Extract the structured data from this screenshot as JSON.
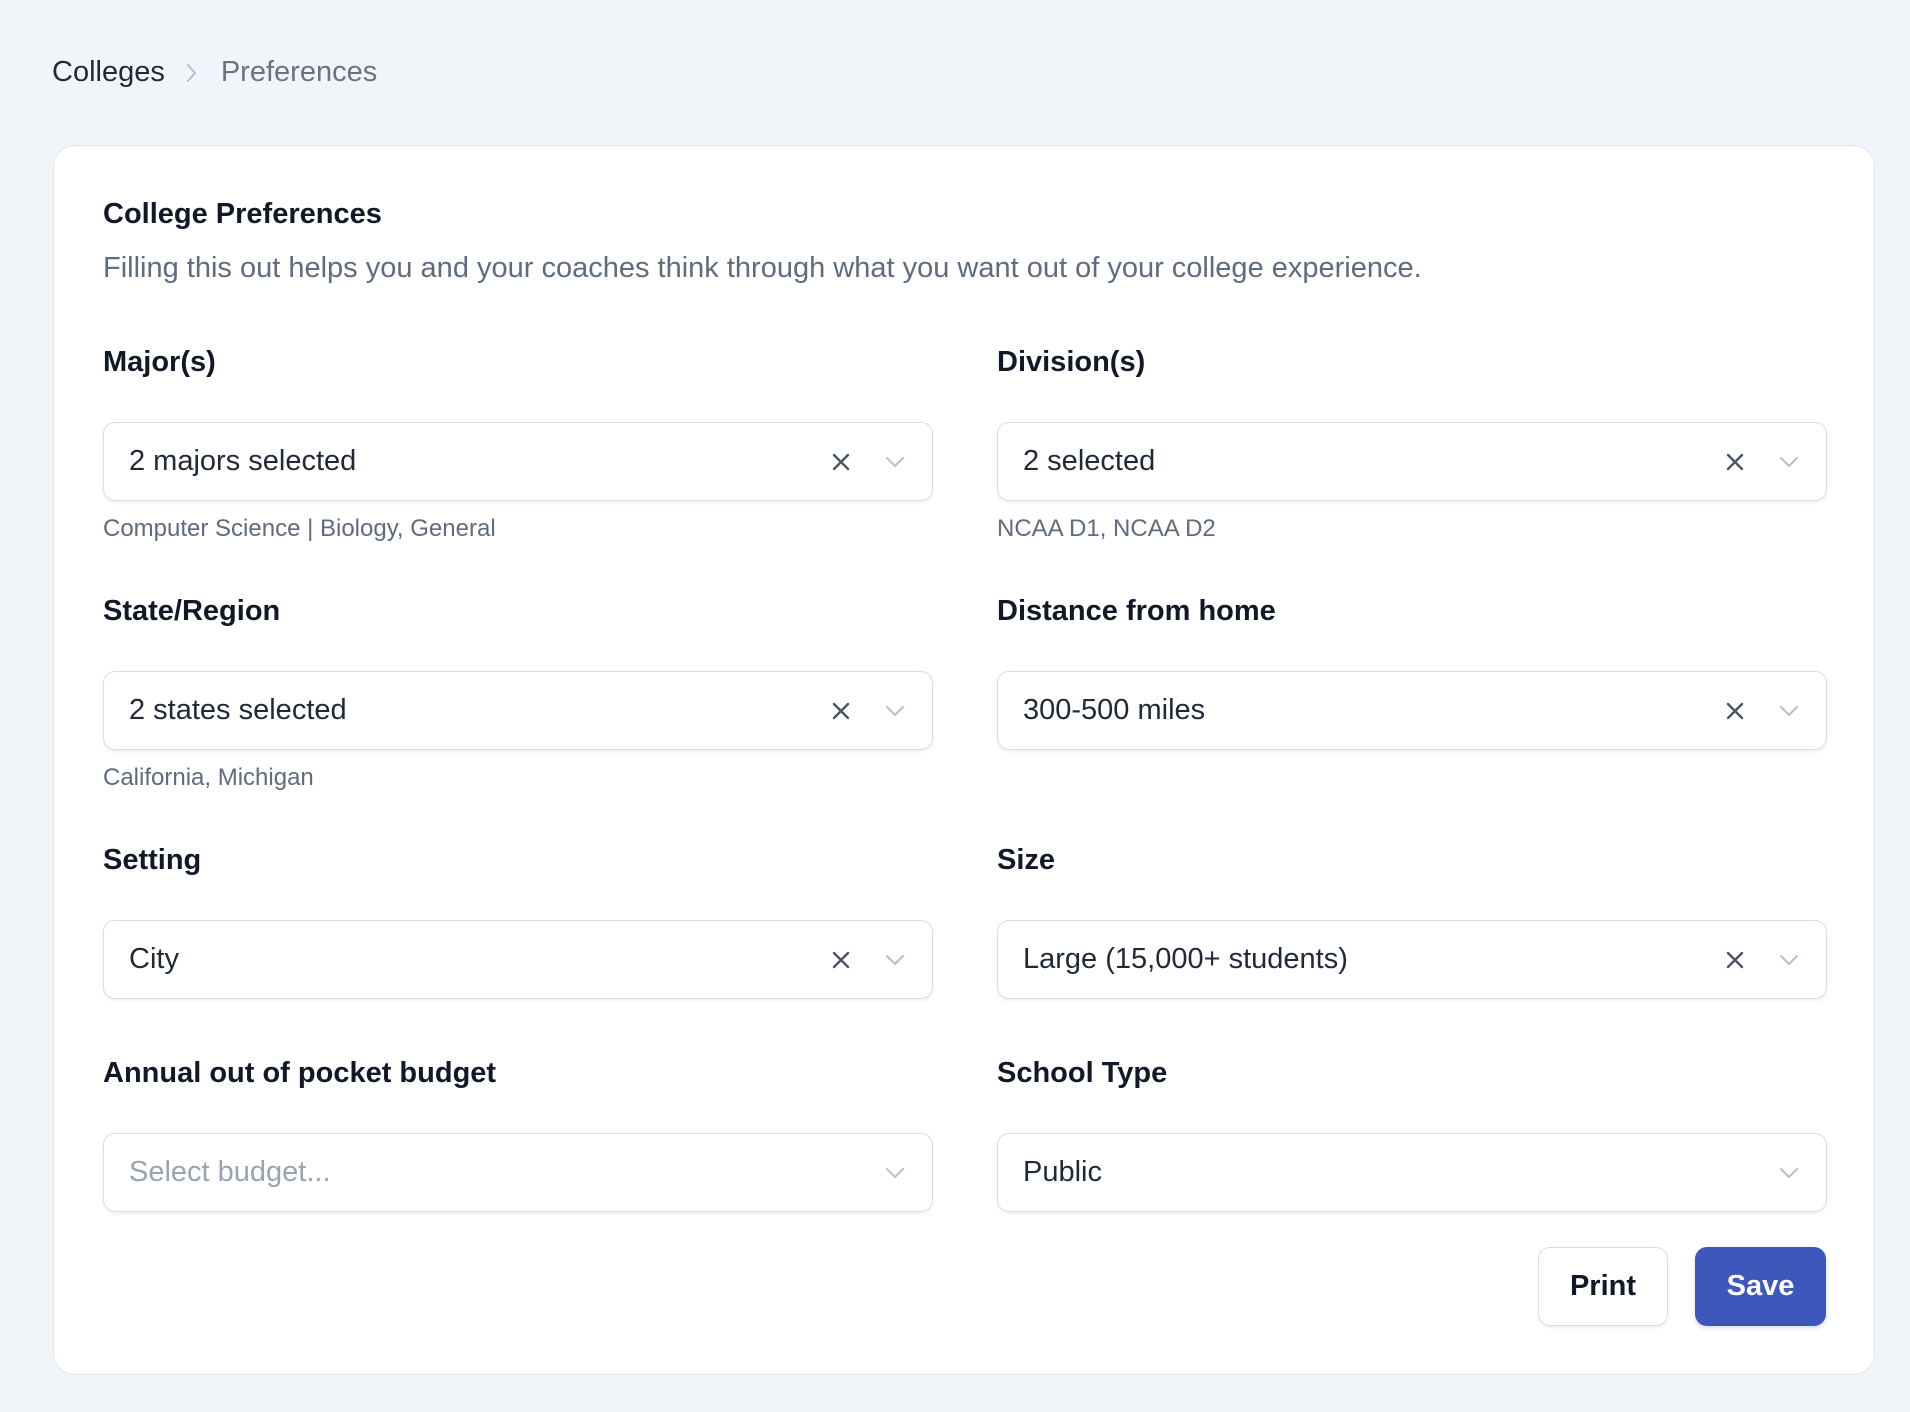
{
  "breadcrumb": {
    "root": "Colleges",
    "current": "Preferences"
  },
  "card": {
    "title": "College Preferences",
    "description": "Filling this out helps you and your coaches think through what you want out of your college experience."
  },
  "fields": {
    "majors": {
      "label": "Major(s)",
      "value": "2 majors selected",
      "hint": "Computer Science | Biology, General"
    },
    "divisions": {
      "label": "Division(s)",
      "value": "2 selected",
      "hint": "NCAA D1, NCAA D2"
    },
    "state_region": {
      "label": "State/Region",
      "value": "2 states selected",
      "hint": "California, Michigan"
    },
    "distance": {
      "label": "Distance from home",
      "value": "300-500 miles"
    },
    "setting": {
      "label": "Setting",
      "value": "City"
    },
    "size": {
      "label": "Size",
      "value": "Large (15,000+ students)"
    },
    "budget": {
      "label": "Annual out of pocket budget",
      "placeholder": "Select budget..."
    },
    "school_type": {
      "label": "School Type",
      "value": "Public"
    }
  },
  "actions": {
    "print_label": "Print",
    "save_label": "Save"
  },
  "icons": {
    "breadcrumb_separator": "chevron-right-icon",
    "clear": "close-icon",
    "dropdown": "chevron-down-icon"
  },
  "colors": {
    "primary": "#3e57bb",
    "background": "#f1f4f9",
    "muted_text": "#5f6b7e",
    "placeholder": "#9aa3b2"
  }
}
